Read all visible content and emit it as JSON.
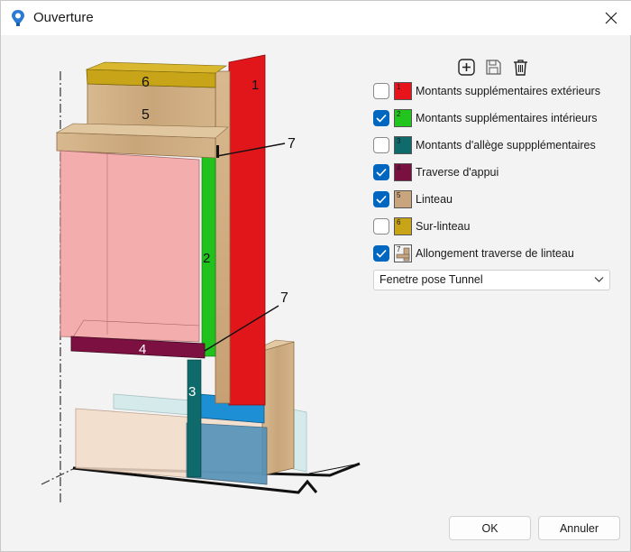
{
  "window": {
    "title": "Ouverture"
  },
  "toolbar": {
    "add_icon": "add-square-icon",
    "save_icon": "save-icon",
    "delete_icon": "trash-icon"
  },
  "options": [
    {
      "number": "1",
      "label": "Montants supplémentaires extérieurs",
      "checked": false,
      "color": "#e8141b"
    },
    {
      "number": "2",
      "label": "Montants supplémentaires intérieurs",
      "checked": true,
      "color": "#22c41e"
    },
    {
      "number": "3",
      "label": "Montants d'allège suppplémentaires",
      "checked": false,
      "color": "#0f6b6b"
    },
    {
      "number": "4",
      "label": "Traverse d'appui",
      "checked": true,
      "color": "#7a1040"
    },
    {
      "number": "5",
      "label": "Linteau",
      "checked": true,
      "color": "#c9a57e"
    },
    {
      "number": "6",
      "label": "Sur-linteau",
      "checked": false,
      "color": "#c7a418"
    },
    {
      "number": "7",
      "label": "Allongement traverse de linteau",
      "checked": true,
      "color": "#ffffff"
    }
  ],
  "dropdown": {
    "selected": "Fenetre pose Tunnel"
  },
  "buttons": {
    "ok": "OK",
    "cancel": "Annuler"
  },
  "drawing_labels": {
    "l1": "1",
    "l2": "2",
    "l3": "3",
    "l4": "4",
    "l5": "5",
    "l6": "6",
    "l7a": "7",
    "l7b": "7"
  }
}
